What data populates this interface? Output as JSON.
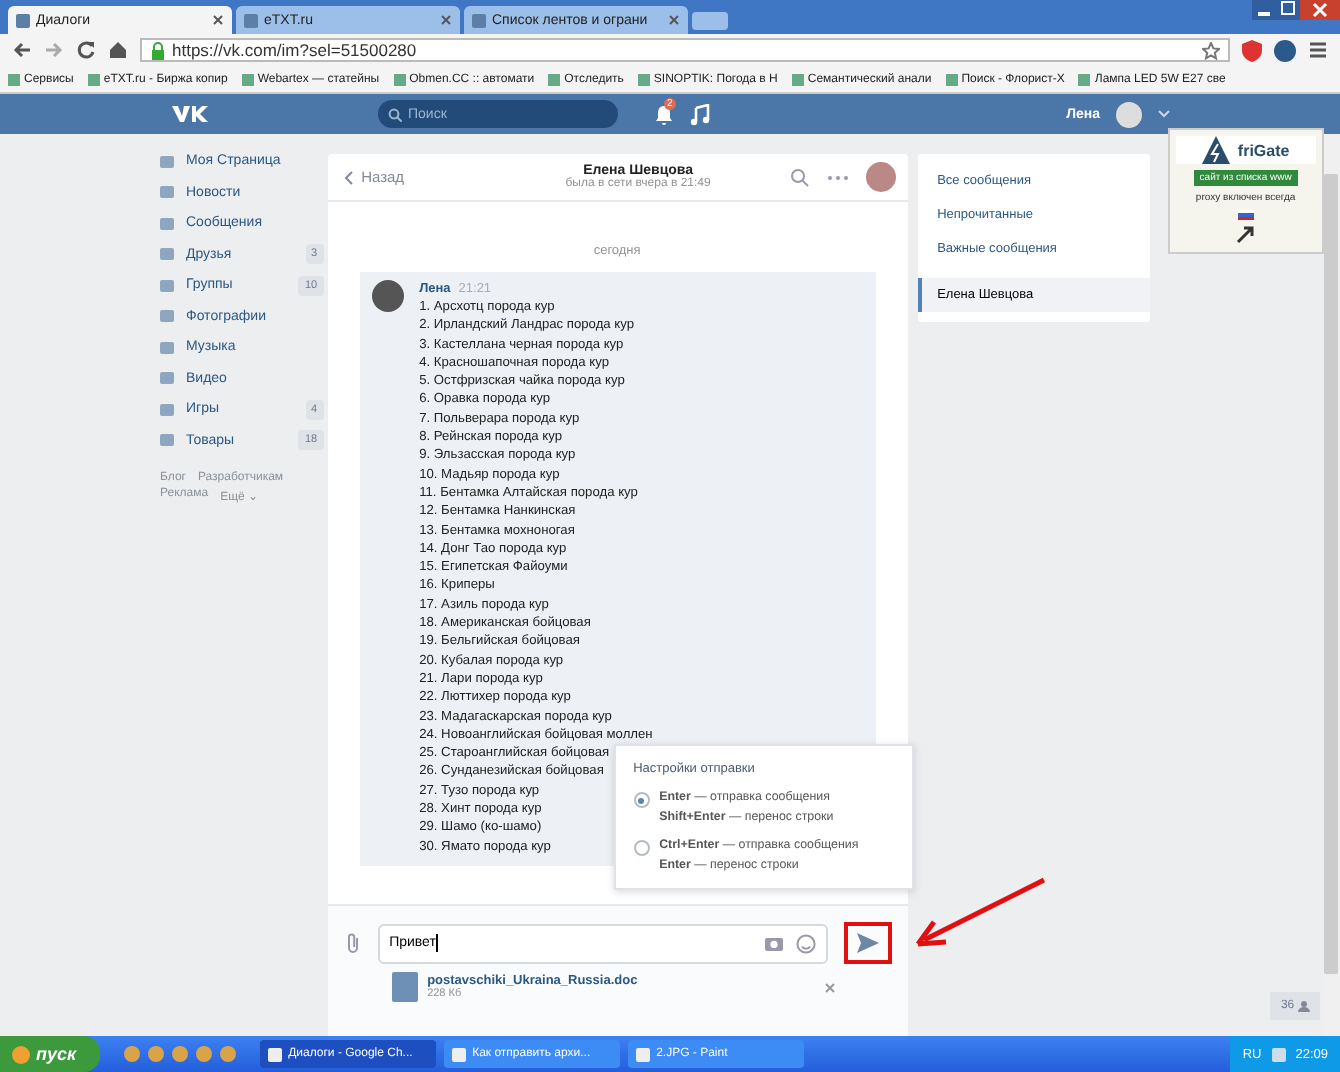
{
  "browser": {
    "tabs": [
      {
        "title": "Диалоги",
        "selected": true
      },
      {
        "title": "eTXT.ru",
        "selected": false
      },
      {
        "title": "Список лентов и ограни",
        "selected": false
      }
    ],
    "url": "https://vk.com/im?sel=51500280",
    "bookmarks": [
      "Сервисы",
      "eTXT.ru - Биржа копир",
      "Webartex — статейны",
      "Obmen.CC :: автомати",
      "Отследить",
      "SINOPTIK: Погода в Н",
      "Семантический анали",
      "Поиск - Флорист-Х",
      "Лампа LED 5W E27 све"
    ]
  },
  "header": {
    "search_placeholder": "Поиск",
    "notifications": "2",
    "user": "Лена"
  },
  "sidebar": {
    "items": [
      {
        "label": "Моя Страница"
      },
      {
        "label": "Новости"
      },
      {
        "label": "Сообщения"
      },
      {
        "label": "Друзья",
        "count": "3"
      },
      {
        "label": "Группы",
        "count": "10"
      },
      {
        "label": "Фотографии"
      },
      {
        "label": "Музыка"
      },
      {
        "label": "Видео"
      },
      {
        "label": "Игры",
        "count": "4"
      },
      {
        "label": "Товары",
        "count": "18"
      }
    ],
    "footer_links": [
      "Блог",
      "Разработчикам",
      "Реклама",
      "Ещё ⌄"
    ]
  },
  "chat": {
    "back": "Назад",
    "name": "Елена Шевцова",
    "status": "была в сети вчера в 21:49",
    "date": "сегодня",
    "message": {
      "author": "Лена",
      "time": "21:21",
      "lines": [
        "1. Арсхотц порода кур",
        "2. Ирландский Ландрас порода кур",
        "3. Кастеллана черная порода кур",
        "4. Красношапочная порода кур",
        "5. Остфризская чайка порода кур",
        "6. Оравка порода кур",
        "7. Польверара порода кур",
        "8. Рейнская порода кур",
        "9. Эльзасская порода кур",
        "10. Мадьяр порода кур",
        "11. Бентамка Алтайская порода кур",
        "12. Бентамка Нанкинская",
        "13. Бентамка мохноногая",
        "14. Донг Тао порода кур",
        "15. Египетская Файоуми",
        "16. Криперы",
        "17. Азиль порода кур",
        "18. Американская бойцовая",
        "19. Бельгийская бойцовая",
        "20. Кубалая порода кур",
        "21. Лари порода кур",
        "22. Люттихер порода кур",
        "23. Мадагаскарская порода кур",
        "24. Новоанглийская бойцовая моллен",
        "25. Староанглийская бойцовая",
        "26. Сунданезийская бойцовая",
        "27. Тузо порода кур",
        "28. Хинт порода кур",
        "29. Шамо (ко-шамо)",
        "30. Ямато порода кур"
      ]
    },
    "send_settings": {
      "title": "Настройки отправки",
      "options": [
        {
          "selected": true,
          "lines": [
            "**Enter** — отправка сообщения",
            "**Shift+Enter** — перенос строки"
          ]
        },
        {
          "selected": false,
          "lines": [
            "**Ctrl+Enter** — отправка сообщения",
            "**Enter** — перенос строки"
          ]
        }
      ]
    },
    "composer": {
      "value": "Привет",
      "attachment": {
        "name": "postavschiki_Ukraina_Russia.doc",
        "size": "228 Кб"
      }
    }
  },
  "filters": [
    {
      "label": "Все сообщения",
      "selected": false
    },
    {
      "label": "Непрочитанные",
      "selected": false
    },
    {
      "label": "Важные сообщения",
      "selected": false
    },
    {
      "label": "Елена Шевцова",
      "selected": true
    }
  ],
  "frigate": {
    "title": "friGate",
    "status": "сайт из списка www",
    "proxy": "proxy включен всегда"
  },
  "online_count": "36",
  "taskbar": {
    "start": "пуск",
    "tasks": [
      "Диалоги - Google Ch...",
      "Как отправить архи...",
      "2.JPG - Paint"
    ],
    "lang": "RU",
    "time": "22:09"
  }
}
